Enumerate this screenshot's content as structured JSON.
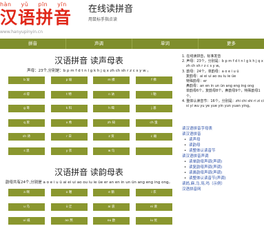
{
  "header": {
    "logo_pinyin": [
      "hàn",
      "yǔ",
      "pīn",
      "yīn"
    ],
    "logo_text": "汉语拼音",
    "logo_url": "www.hanyupinyin.cn",
    "title": "在线读拼音",
    "subtitle": "用鼠标手指点读"
  },
  "nav": [
    "拼音",
    "声调",
    "单词",
    "更多"
  ],
  "initials": {
    "title": "汉语拼音 读声母表",
    "desc": "声母：23个,分别是：b p m f d t n l g k h j q x zh ch sh r z c s y w 。",
    "cells": [
      "b 玻",
      "p 坡",
      "m 摸",
      "f 佛",
      "d 得",
      "t 特",
      "n 讷",
      "l 勒",
      "g 哥",
      "k 科",
      "h 喝",
      "j 基",
      "q 欺",
      "x 希",
      "zh 知",
      "ch 蚩",
      "sh 诗",
      "r 日",
      "z 资",
      "c 雌",
      "s 思",
      "y 衣",
      "w 乌",
      ""
    ]
  },
  "finals": {
    "title": "汉语拼音 读韵母表",
    "desc": "韵母共有24个,分别是 a o e i u ü ai ei ui ao ou iu ie üe er an en in un ün ang eng ing ong。",
    "cells": [
      "a 啊",
      "o 喔",
      "e 鹅",
      "i 衣",
      "u 乌",
      "ü 迂",
      "ai 哀",
      "ei 诶",
      "ui 威",
      "ao 熬",
      "ou 欧",
      "iu 优"
    ]
  },
  "sidebar": {
    "lines": [
      "1. 在线读拼音，标准发音",
      "2. 声母：23个，分别是：b p m f d t n l g k h j q x",
      "zh ch sh r z c s y w。",
      "3. 韵母：24个，单韵母：a o e i u ü",
      "复韵母：ai ei ui ao ou iu ie üe",
      "特殊韵母：er",
      "鼻韵母：an en in un ün ang eng ing ong",
      "单韵母6个，复韵母8个，鼻韵母9个，特殊韵母1",
      "个。",
      "4. 整体认读音节：16个，分别是：zhi chi shi ri zi ci",
      "si yi wu yu ye yue yin yun yuan ying。"
    ],
    "links": [
      "读汉语拼音字母表",
      "读汉语拼音",
      "读声母",
      "读韵母",
      "读整体认读音节",
      "读汉语拼音声调",
      "读单韵母声调(声调)",
      "读复韵母声调(声调)",
      "读鼻韵母声调(声调)",
      "读整体认读音节(声调)",
      "读妈,麻,马,骂,吗（示例）",
      "汉语拼音网"
    ]
  }
}
